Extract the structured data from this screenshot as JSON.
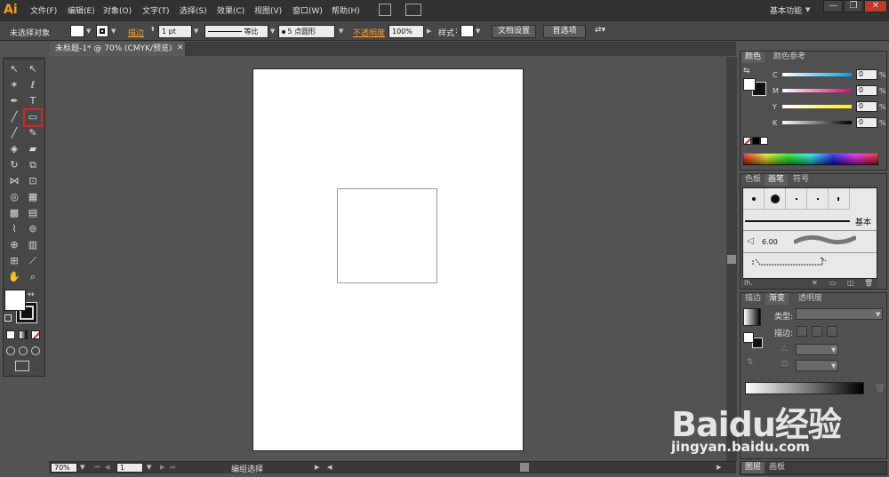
{
  "app": {
    "logo": "Ai"
  },
  "menu": {
    "items": [
      "文件(F)",
      "编辑(E)",
      "对象(O)",
      "文字(T)",
      "选择(S)",
      "效果(C)",
      "视图(V)",
      "窗口(W)",
      "帮助(H)"
    ],
    "workspace": "基本功能",
    "win_buttons": [
      "—",
      "❐",
      "✕"
    ]
  },
  "control": {
    "selection_status": "未选择对象",
    "stroke_label": "描边",
    "stroke_weight": "1 pt",
    "stroke_profile": "等比",
    "brush_def": "5 点圆形",
    "opacity_label": "不透明度",
    "opacity_value": "100%",
    "style_label": "样式",
    "doc_setup_button": "文档设置",
    "prefs_button": "首选项"
  },
  "document": {
    "tab_title": "未标题-1* @ 70% (CMYK/预览)",
    "close_glyph": "✕"
  },
  "status": {
    "zoom": "70%",
    "page": "1",
    "status_text": "编组选择"
  },
  "panels": {
    "color": {
      "tabs": [
        "颜色",
        "颜色参考"
      ],
      "sliders": [
        {
          "label": "C",
          "value": "0",
          "color": "#00a0e9"
        },
        {
          "label": "M",
          "value": "0",
          "color": "#e4007f"
        },
        {
          "label": "Y",
          "value": "0",
          "color": "#fff100"
        },
        {
          "label": "K",
          "value": "0",
          "color": "#000000"
        }
      ],
      "percent": "%"
    },
    "brushes": {
      "tabs": [
        "色板",
        "画笔",
        "符号"
      ],
      "basic_label": "基本",
      "size_value": "6.00"
    },
    "gradient": {
      "tabs": [
        "描边",
        "渐变",
        "透明度"
      ],
      "type_label": "类型:",
      "stroke_label": "描边:"
    },
    "layers": {
      "tabs": [
        "图层",
        "画板"
      ]
    }
  },
  "watermark": {
    "brand": "Baidu经验",
    "url": "jingyan.baidu.com"
  }
}
